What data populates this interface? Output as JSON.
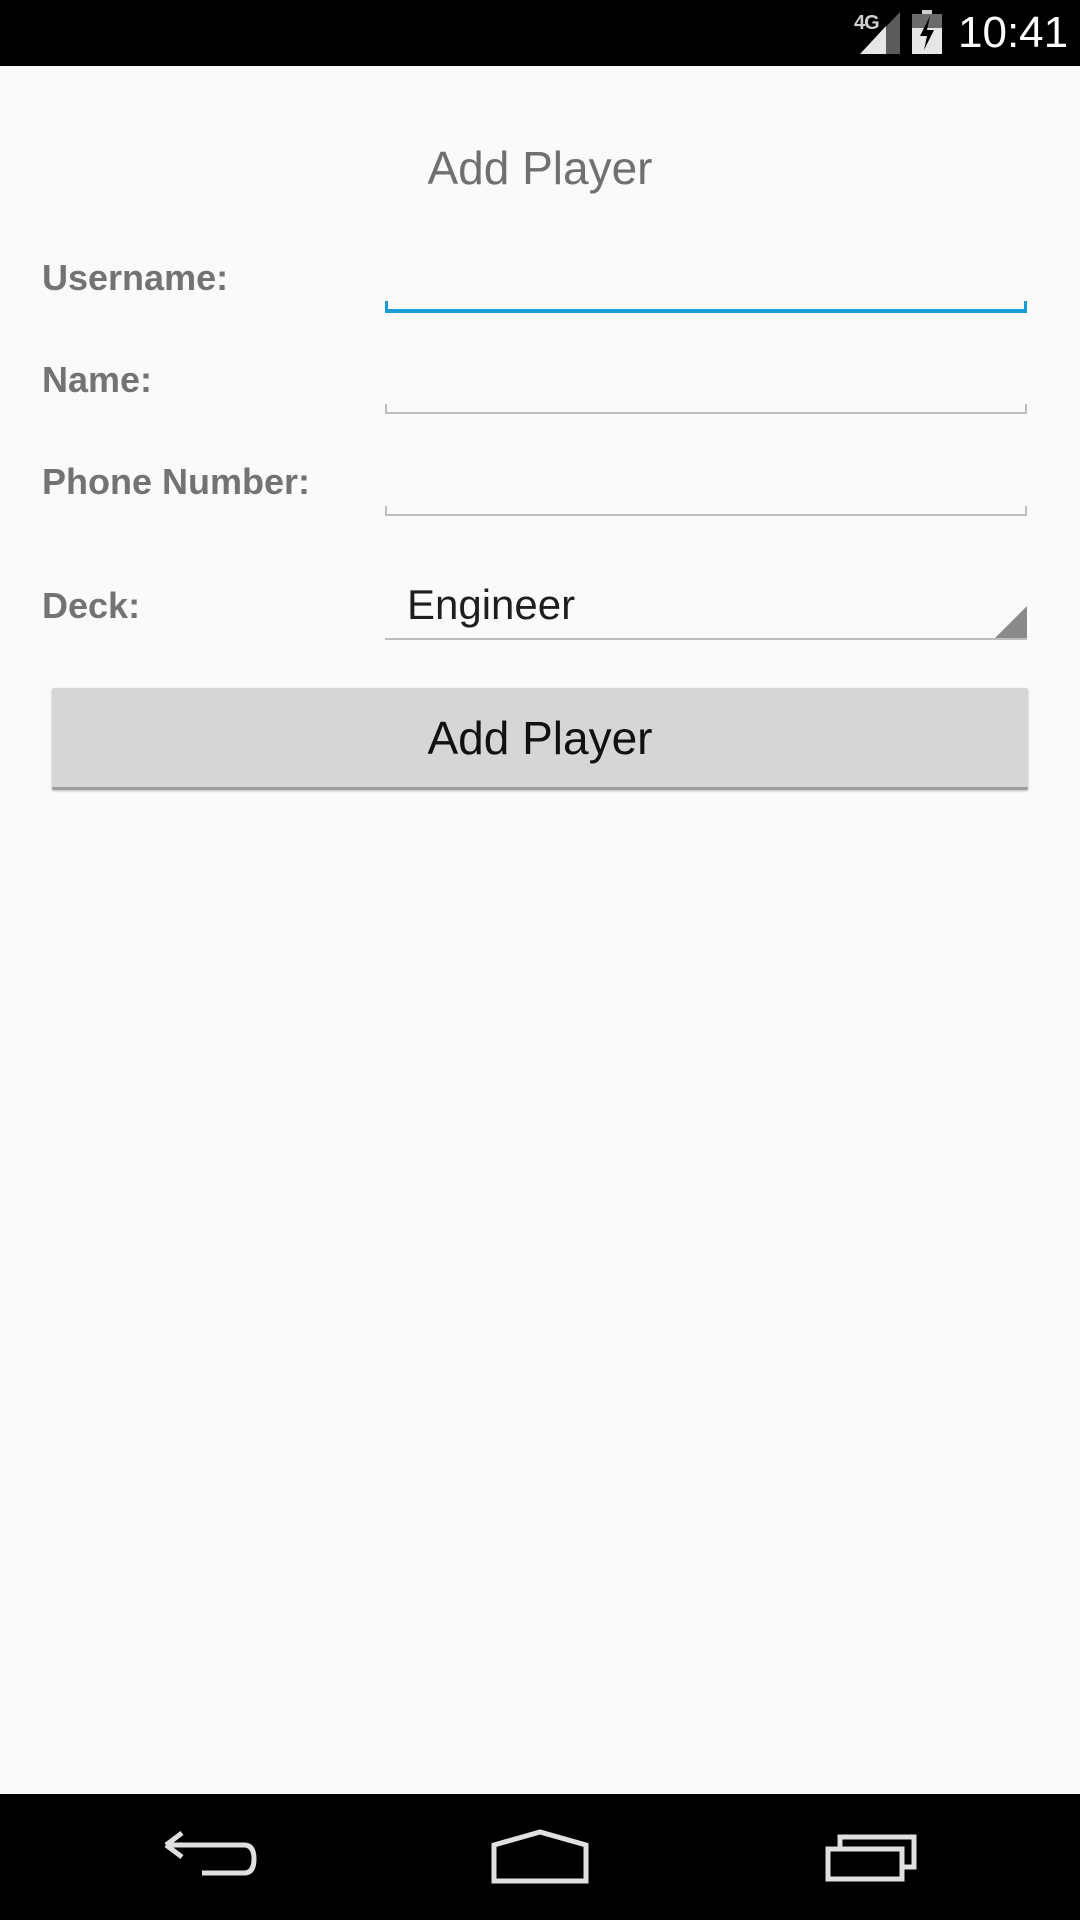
{
  "status_bar": {
    "network": "4G",
    "time": "10:41"
  },
  "page": {
    "title": "Add Player"
  },
  "form": {
    "username": {
      "label": "Username:",
      "value": ""
    },
    "name": {
      "label": "Name:",
      "value": ""
    },
    "phone": {
      "label": "Phone Number:",
      "value": ""
    },
    "deck": {
      "label": "Deck:",
      "selected": "Engineer"
    }
  },
  "actions": {
    "add_player_label": "Add Player"
  },
  "nav": {
    "back": "back-icon",
    "home": "home-icon",
    "recents": "recent-apps-icon"
  },
  "colors": {
    "focus_accent": "#1a9bd2",
    "background": "#fafafa",
    "button": "#d6d6d6"
  }
}
